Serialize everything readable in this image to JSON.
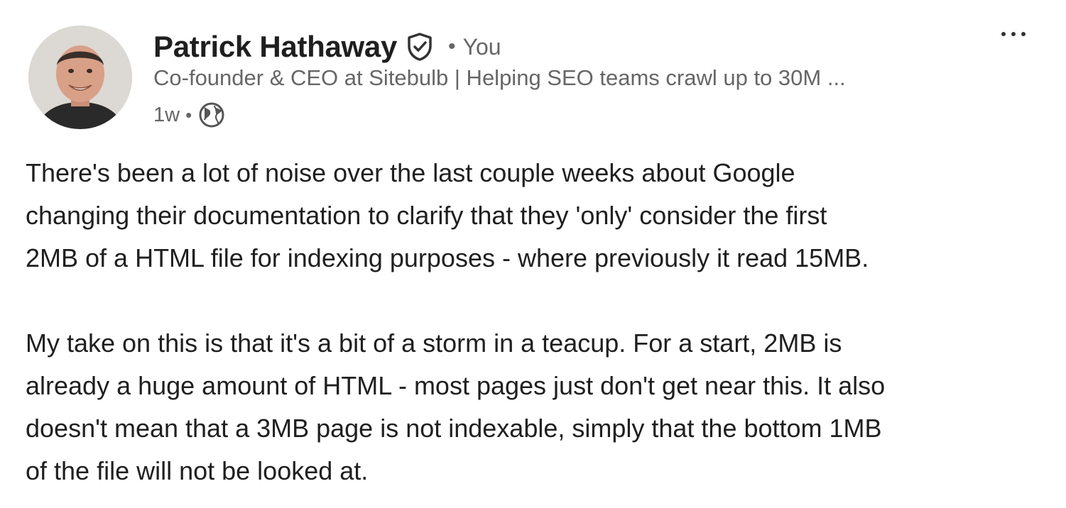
{
  "author": {
    "name": "Patrick Hathaway",
    "relation_separator": "•",
    "relation": "You",
    "headline": "Co-founder & CEO at Sitebulb | Helping SEO teams crawl up to 30M ...",
    "posted_ago": "1w",
    "meta_separator": "•",
    "verified_icon": "verified-shield-icon",
    "visibility_icon": "globe-icon"
  },
  "menu": {
    "more_icon": "ellipsis-icon"
  },
  "post": {
    "paragraphs": [
      "There's been a lot of noise over the last couple weeks about Google\nchanging their documentation to clarify that they 'only' consider the first\n2MB of a HTML file for indexing purposes - where previously it read 15MB.",
      "My take on this is that it's a bit of a storm in a teacup. For a start, 2MB is\nalready a huge amount of HTML - most pages just don't get near this. It also\ndoesn't mean that a 3MB page is not indexable, simply that the bottom 1MB\nof the file will not be looked at."
    ]
  },
  "colors": {
    "text_primary": "#1f1f1f",
    "text_secondary": "#666666",
    "background": "#ffffff"
  }
}
